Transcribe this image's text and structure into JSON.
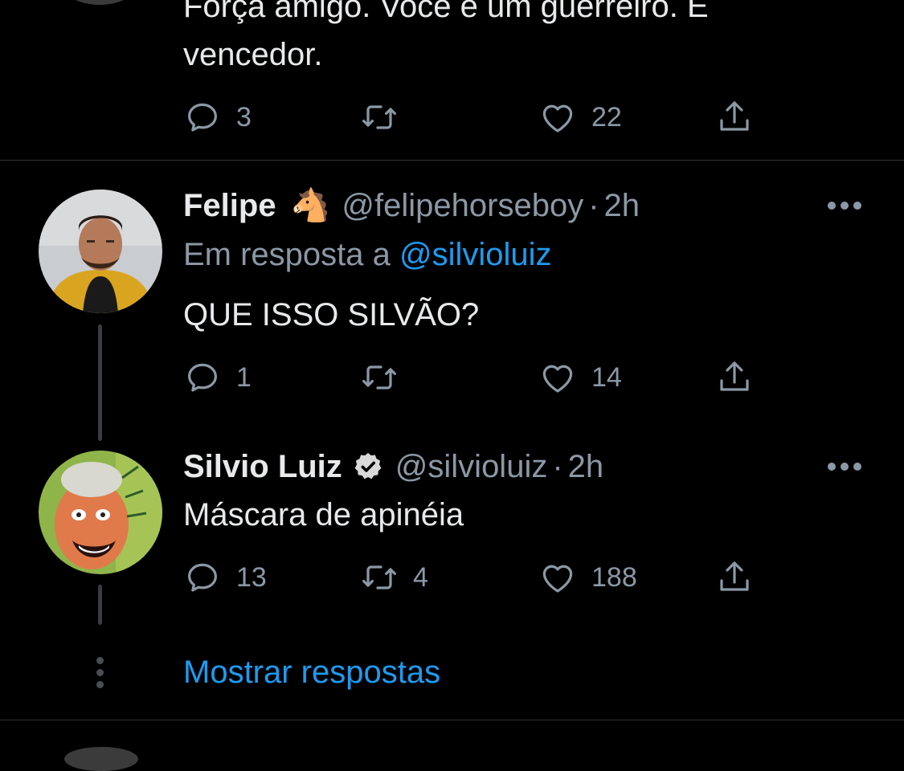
{
  "previous_tweet": {
    "text": "Força amigo. Você é um guerreiro. É\nvencedor.",
    "actions": {
      "reply_count": "3",
      "retweet_count": "",
      "like_count": "22"
    }
  },
  "tweets": [
    {
      "name": "Felipe",
      "emoji": "🐴",
      "handle": "@felipehorseboy",
      "separator": "·",
      "time": "2h",
      "reply_prefix": "Em resposta a",
      "reply_mention": "@silvioluiz",
      "text": "QUE ISSO SILVÃO?",
      "actions": {
        "reply_count": "1",
        "retweet_count": "",
        "like_count": "14"
      }
    },
    {
      "name": "Silvio Luiz",
      "handle": "@silvioluiz",
      "separator": "·",
      "time": "2h",
      "text": "Máscara de apinéia",
      "actions": {
        "reply_count": "13",
        "retweet_count": "4",
        "like_count": "188"
      }
    }
  ],
  "show_replies_label": "Mostrar respostas",
  "colors": {
    "background": "#000000",
    "primary_text": "#e7e9ea",
    "secondary_text": "#8b98a5",
    "link": "#1d9bf0",
    "divider": "#2f3336"
  },
  "icons": {
    "reply": "reply-icon",
    "retweet": "retweet-icon",
    "like": "heart-icon",
    "share": "share-icon",
    "more": "more-icon",
    "verified": "verified-badge-icon"
  }
}
